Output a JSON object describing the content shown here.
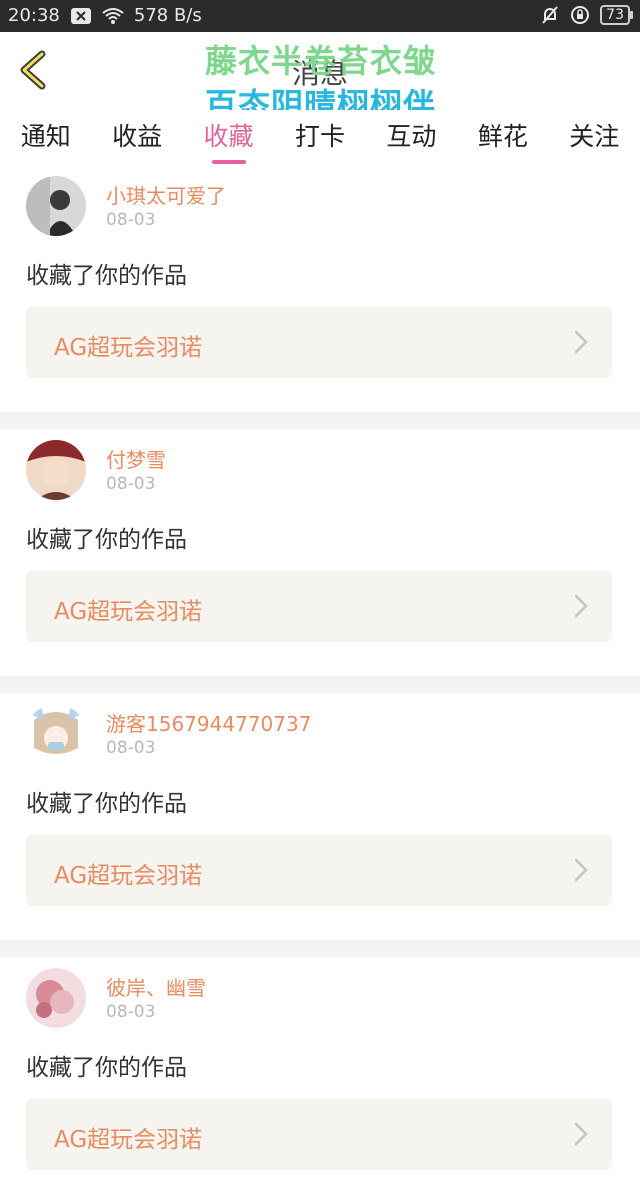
{
  "status_bar": {
    "time": "20:38",
    "network_speed": "578 B/s",
    "battery": "73"
  },
  "header": {
    "title": "消息",
    "overlay_line1": "藤衣半卷苔衣皱",
    "overlay_line2": "百态阴晴栩栩伴"
  },
  "tabs": [
    {
      "label": "通知"
    },
    {
      "label": "收益"
    },
    {
      "label": "收藏",
      "active": true
    },
    {
      "label": "打卡"
    },
    {
      "label": "互动"
    },
    {
      "label": "鲜花"
    },
    {
      "label": "关注"
    }
  ],
  "items": [
    {
      "username": "小琪太可爱了",
      "date": "08-03",
      "action": "收藏了你的作品",
      "work": "AG超玩会羽诺"
    },
    {
      "username": "付梦雪",
      "date": "08-03",
      "action": "收藏了你的作品",
      "work": "AG超玩会羽诺"
    },
    {
      "username": "游客1567944770737",
      "date": "08-03",
      "action": "收藏了你的作品",
      "work": "AG超玩会羽诺"
    },
    {
      "username": "彼岸、幽雪",
      "date": "08-03",
      "action": "收藏了你的作品",
      "work": "AG超玩会羽诺"
    }
  ],
  "colors": {
    "accent_tab": "#e263a0",
    "username": "#e88b62",
    "status_bar_bg": "#2b2b2b"
  },
  "icons": {
    "back": "chevron-left-icon",
    "row_arrow": "chevron-right-icon"
  }
}
